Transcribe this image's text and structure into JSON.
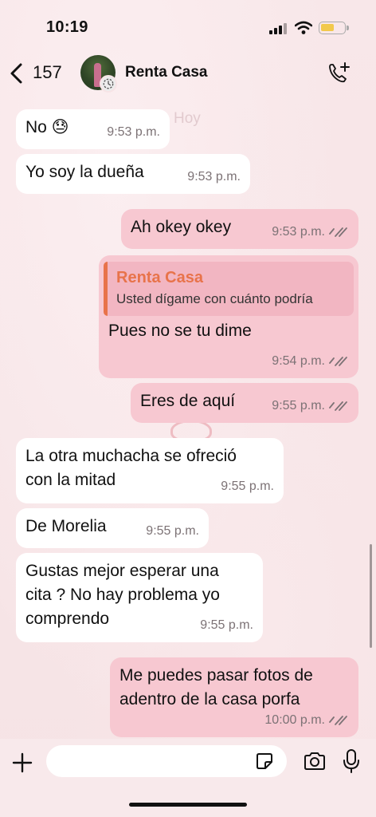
{
  "status_bar": {
    "time": "10:19"
  },
  "header": {
    "back_count": "157",
    "contact_name": "Renta Casa"
  },
  "day_label": "Hoy",
  "messages": [
    {
      "dir": "in",
      "text": "No 😓",
      "time": "9:53 p.m."
    },
    {
      "dir": "in",
      "text": "Yo soy la dueña",
      "time": "9:53 p.m."
    },
    {
      "dir": "out",
      "text": "Ah okey okey",
      "time": "9:53 p.m."
    },
    {
      "dir": "out",
      "quote_name": "Renta Casa",
      "quote_text": "Usted dígame con cuánto podría",
      "text": "Pues no se tu dime",
      "time": "9:54 p.m."
    },
    {
      "dir": "out",
      "text": "Eres de aquí",
      "time": "9:55 p.m."
    },
    {
      "dir": "in",
      "line1": "La otra muchacha se ofreció",
      "line2": "con la mitad",
      "time": "9:55 p.m."
    },
    {
      "dir": "in",
      "text": "De Morelia",
      "time": "9:55 p.m."
    },
    {
      "dir": "in",
      "line1": "Gustas mejor esperar una",
      "line2": "cita ? No hay problema yo",
      "line3": "comprendo",
      "time": "9:55 p.m."
    },
    {
      "dir": "out",
      "line1": "Me puedes pasar fotos de",
      "line2": "adentro de la casa porfa",
      "time": "10:00 p.m."
    }
  ],
  "colors": {
    "incoming": "#ffffff",
    "outgoing": "#f7c8d1",
    "quote_accent": "#e8734a",
    "background": "#f7e4e6"
  },
  "icons": [
    "back-chevron-icon",
    "add-call-icon",
    "plus-icon",
    "sticker-icon",
    "camera-icon",
    "microphone-icon",
    "read-ticks-icon"
  ]
}
